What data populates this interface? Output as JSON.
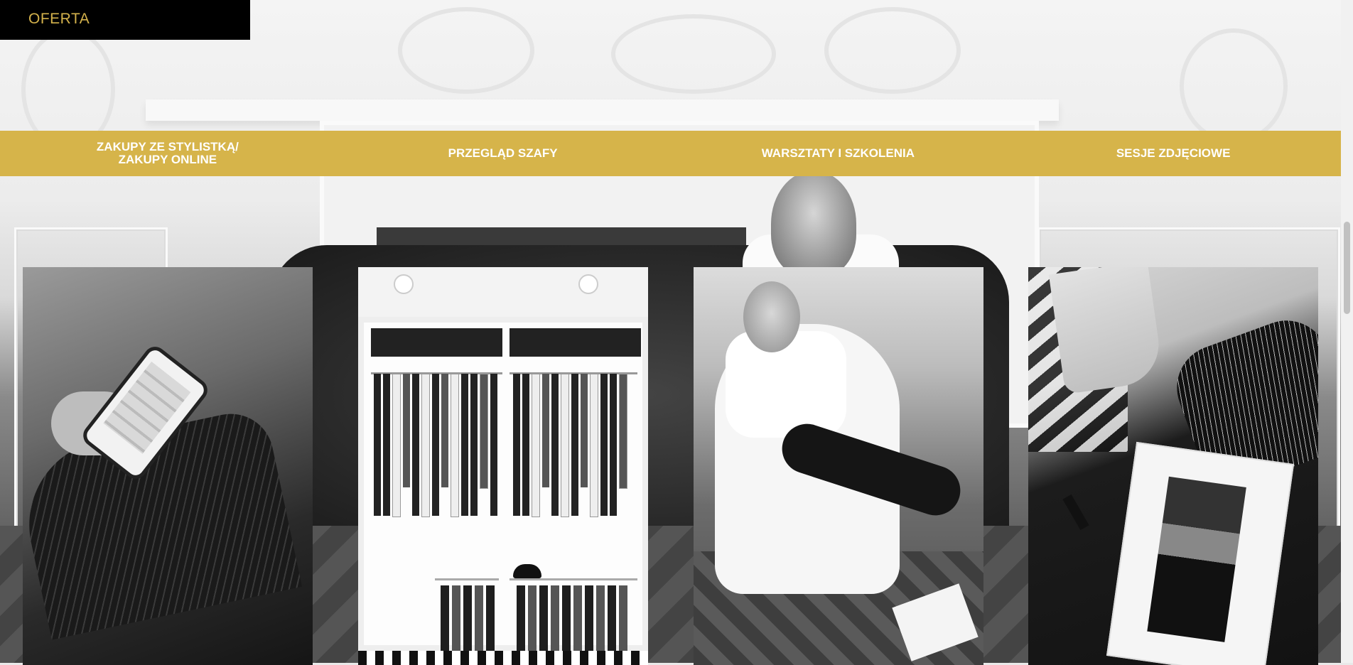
{
  "header": {
    "title": "OFERTA"
  },
  "nav": {
    "items": [
      {
        "line1": "ZAKUPY ZE STYLISTKĄ/",
        "line2": "ZAKUPY ONLINE"
      },
      {
        "line1": "PRZEGLĄD SZAFY",
        "line2": ""
      },
      {
        "line1": "WARSZTATY I SZKOLENIA",
        "line2": ""
      },
      {
        "line1": "SESJE ZDJĘCIOWE",
        "line2": ""
      }
    ]
  },
  "colors": {
    "accent_gold": "#d6b44a",
    "header_bg": "#000000",
    "header_text": "#d4b24c",
    "nav_text": "#ffffff"
  },
  "cards": [
    {
      "image": "phone-shopping-photo"
    },
    {
      "image": "wardrobe-photo"
    },
    {
      "image": "workshop-chair-photo"
    },
    {
      "image": "photo-session-magazine-photo"
    }
  ]
}
